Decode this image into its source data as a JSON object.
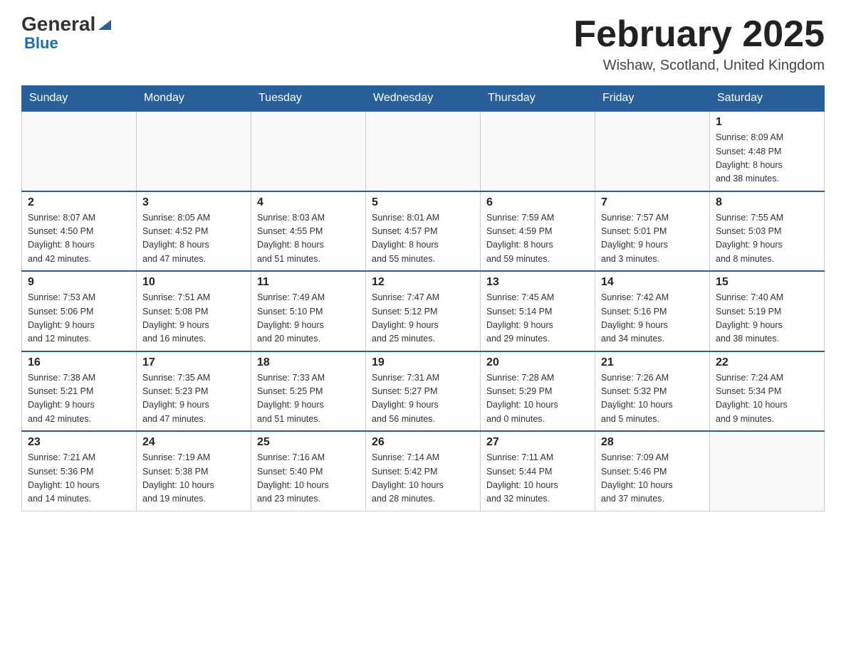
{
  "header": {
    "logo_general": "General",
    "logo_blue": "Blue",
    "month_title": "February 2025",
    "location": "Wishaw, Scotland, United Kingdom"
  },
  "weekdays": [
    "Sunday",
    "Monday",
    "Tuesday",
    "Wednesday",
    "Thursday",
    "Friday",
    "Saturday"
  ],
  "weeks": [
    [
      {
        "day": "",
        "info": ""
      },
      {
        "day": "",
        "info": ""
      },
      {
        "day": "",
        "info": ""
      },
      {
        "day": "",
        "info": ""
      },
      {
        "day": "",
        "info": ""
      },
      {
        "day": "",
        "info": ""
      },
      {
        "day": "1",
        "info": "Sunrise: 8:09 AM\nSunset: 4:48 PM\nDaylight: 8 hours\nand 38 minutes."
      }
    ],
    [
      {
        "day": "2",
        "info": "Sunrise: 8:07 AM\nSunset: 4:50 PM\nDaylight: 8 hours\nand 42 minutes."
      },
      {
        "day": "3",
        "info": "Sunrise: 8:05 AM\nSunset: 4:52 PM\nDaylight: 8 hours\nand 47 minutes."
      },
      {
        "day": "4",
        "info": "Sunrise: 8:03 AM\nSunset: 4:55 PM\nDaylight: 8 hours\nand 51 minutes."
      },
      {
        "day": "5",
        "info": "Sunrise: 8:01 AM\nSunset: 4:57 PM\nDaylight: 8 hours\nand 55 minutes."
      },
      {
        "day": "6",
        "info": "Sunrise: 7:59 AM\nSunset: 4:59 PM\nDaylight: 8 hours\nand 59 minutes."
      },
      {
        "day": "7",
        "info": "Sunrise: 7:57 AM\nSunset: 5:01 PM\nDaylight: 9 hours\nand 3 minutes."
      },
      {
        "day": "8",
        "info": "Sunrise: 7:55 AM\nSunset: 5:03 PM\nDaylight: 9 hours\nand 8 minutes."
      }
    ],
    [
      {
        "day": "9",
        "info": "Sunrise: 7:53 AM\nSunset: 5:06 PM\nDaylight: 9 hours\nand 12 minutes."
      },
      {
        "day": "10",
        "info": "Sunrise: 7:51 AM\nSunset: 5:08 PM\nDaylight: 9 hours\nand 16 minutes."
      },
      {
        "day": "11",
        "info": "Sunrise: 7:49 AM\nSunset: 5:10 PM\nDaylight: 9 hours\nand 20 minutes."
      },
      {
        "day": "12",
        "info": "Sunrise: 7:47 AM\nSunset: 5:12 PM\nDaylight: 9 hours\nand 25 minutes."
      },
      {
        "day": "13",
        "info": "Sunrise: 7:45 AM\nSunset: 5:14 PM\nDaylight: 9 hours\nand 29 minutes."
      },
      {
        "day": "14",
        "info": "Sunrise: 7:42 AM\nSunset: 5:16 PM\nDaylight: 9 hours\nand 34 minutes."
      },
      {
        "day": "15",
        "info": "Sunrise: 7:40 AM\nSunset: 5:19 PM\nDaylight: 9 hours\nand 38 minutes."
      }
    ],
    [
      {
        "day": "16",
        "info": "Sunrise: 7:38 AM\nSunset: 5:21 PM\nDaylight: 9 hours\nand 42 minutes."
      },
      {
        "day": "17",
        "info": "Sunrise: 7:35 AM\nSunset: 5:23 PM\nDaylight: 9 hours\nand 47 minutes."
      },
      {
        "day": "18",
        "info": "Sunrise: 7:33 AM\nSunset: 5:25 PM\nDaylight: 9 hours\nand 51 minutes."
      },
      {
        "day": "19",
        "info": "Sunrise: 7:31 AM\nSunset: 5:27 PM\nDaylight: 9 hours\nand 56 minutes."
      },
      {
        "day": "20",
        "info": "Sunrise: 7:28 AM\nSunset: 5:29 PM\nDaylight: 10 hours\nand 0 minutes."
      },
      {
        "day": "21",
        "info": "Sunrise: 7:26 AM\nSunset: 5:32 PM\nDaylight: 10 hours\nand 5 minutes."
      },
      {
        "day": "22",
        "info": "Sunrise: 7:24 AM\nSunset: 5:34 PM\nDaylight: 10 hours\nand 9 minutes."
      }
    ],
    [
      {
        "day": "23",
        "info": "Sunrise: 7:21 AM\nSunset: 5:36 PM\nDaylight: 10 hours\nand 14 minutes."
      },
      {
        "day": "24",
        "info": "Sunrise: 7:19 AM\nSunset: 5:38 PM\nDaylight: 10 hours\nand 19 minutes."
      },
      {
        "day": "25",
        "info": "Sunrise: 7:16 AM\nSunset: 5:40 PM\nDaylight: 10 hours\nand 23 minutes."
      },
      {
        "day": "26",
        "info": "Sunrise: 7:14 AM\nSunset: 5:42 PM\nDaylight: 10 hours\nand 28 minutes."
      },
      {
        "day": "27",
        "info": "Sunrise: 7:11 AM\nSunset: 5:44 PM\nDaylight: 10 hours\nand 32 minutes."
      },
      {
        "day": "28",
        "info": "Sunrise: 7:09 AM\nSunset: 5:46 PM\nDaylight: 10 hours\nand 37 minutes."
      },
      {
        "day": "",
        "info": ""
      }
    ]
  ]
}
